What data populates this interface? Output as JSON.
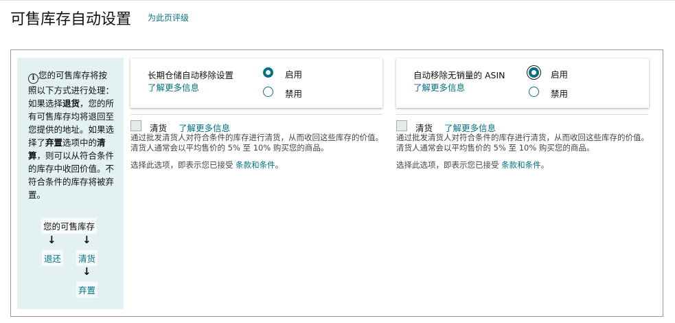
{
  "header": {
    "title": "可售库存自动设置",
    "rate_link": "为此页评级"
  },
  "sidebar": {
    "text_1": "您的可售库存将按照以下方式进行处理：如果选择",
    "bold_1": "退货",
    "text_2": "，您的所有可售库存均将退回至您提供的地址。如果选择了",
    "bold_2": "弃置",
    "text_3": "选项中的",
    "bold_3": "清算",
    "text_4": "，则可以从符合条件的库存中收回价值。不符合条件的库存将被弃置。",
    "flow": {
      "root": "您的可售库存",
      "return": "退还",
      "liquidate": "清货",
      "dispose": "弃置"
    }
  },
  "panels": [
    {
      "label": "长期仓储自动移除设置",
      "more": "了解更多信息",
      "enable": "启用",
      "disable": "禁用",
      "selected": "启用",
      "liquidation": {
        "label": "清货",
        "more": "了解更多信息",
        "checked": false,
        "desc": "通过批发清货人对符合条件的库存进行清货，从而收回这些库存的价值。清货人通常会以平均售价的 5% 至 10% 购买您的商品。",
        "terms_prefix": "选择此选项，即表示您已接受 ",
        "terms_link": "条款和条件",
        "terms_suffix": "。"
      }
    },
    {
      "label": "自动移除无销量的 ASIN",
      "more": "了解更多信息",
      "enable": "启用",
      "disable": "禁用",
      "selected": "启用",
      "liquidation": {
        "label": "清货",
        "more": "了解更多信息",
        "checked": false,
        "desc": "通过批发清货人对符合条件的库存进行清货，从而收回这些库存的价值。清货人通常会以平均售价的 5% 至 10% 购买您的商品。",
        "terms_prefix": "选择此选项，即表示您已接受 ",
        "terms_link": "条款和条件",
        "terms_suffix": "。"
      }
    }
  ]
}
